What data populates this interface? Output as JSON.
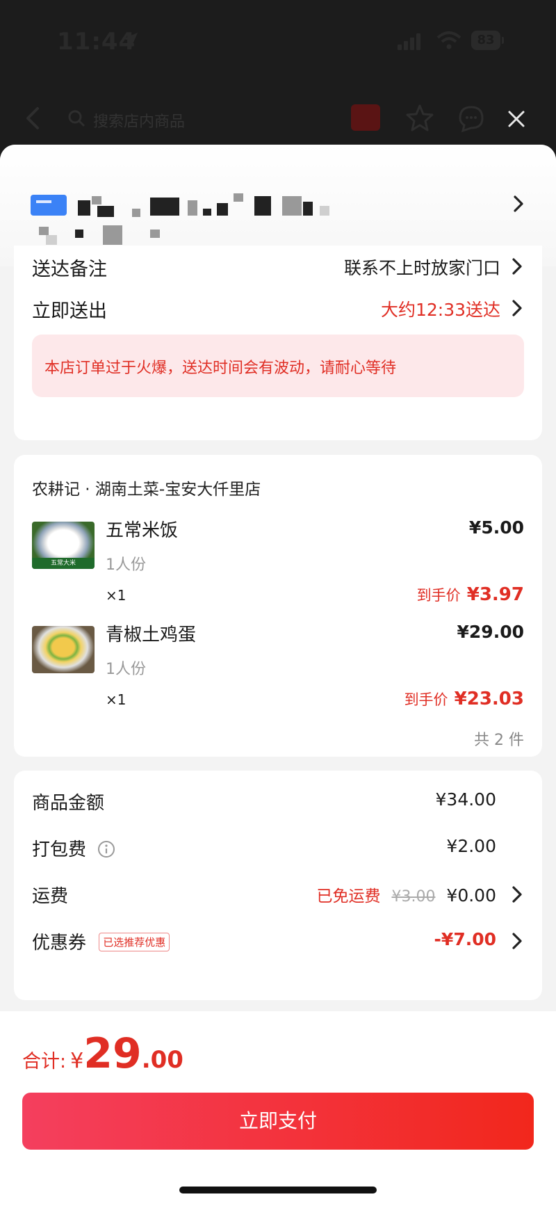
{
  "status_bar": {
    "time": "11:44",
    "battery": "83"
  },
  "nav": {
    "search_placeholder": "搜索店内商品"
  },
  "delivery": {
    "note_label": "送达备注",
    "note_value": "联系不上时放家门口",
    "dispatch_label": "立即送出",
    "dispatch_value": "大约12:33送达",
    "notice": "本店订单过于火爆，送达时间会有波动，请耐心等待"
  },
  "store": {
    "name": "农耕记 · 湖南土菜-宝安大仟里店",
    "items": [
      {
        "name": "五常米饭",
        "spec": "1人份",
        "qty": "×1",
        "price": "¥5.00",
        "final_label": "到手价",
        "final_price": "¥3.97",
        "thumb_text": "五常大米"
      },
      {
        "name": "青椒土鸡蛋",
        "spec": "1人份",
        "qty": "×1",
        "price": "¥29.00",
        "final_label": "到手价",
        "final_price": "¥23.03"
      }
    ],
    "total_count": "共 2 件"
  },
  "fees": {
    "goods_label": "商品金额",
    "goods_amount": "¥34.00",
    "packing_label": "打包费",
    "packing_amount": "¥2.00",
    "shipping_label": "运费",
    "shipping_free": "已免运费",
    "shipping_original": "¥3.00",
    "shipping_amount": "¥0.00",
    "coupon_label": "优惠券",
    "coupon_tag": "已选推荐优惠",
    "coupon_amount": "-¥7.00"
  },
  "summary": {
    "total_label": "合计:",
    "currency": "¥",
    "total_int": "29",
    "total_dec": ".00",
    "pay_label": "立即支付"
  },
  "colors": {
    "accent": "#e02e24",
    "notice_bg": "#fde8ea",
    "address_tag": "#3b82f6"
  }
}
